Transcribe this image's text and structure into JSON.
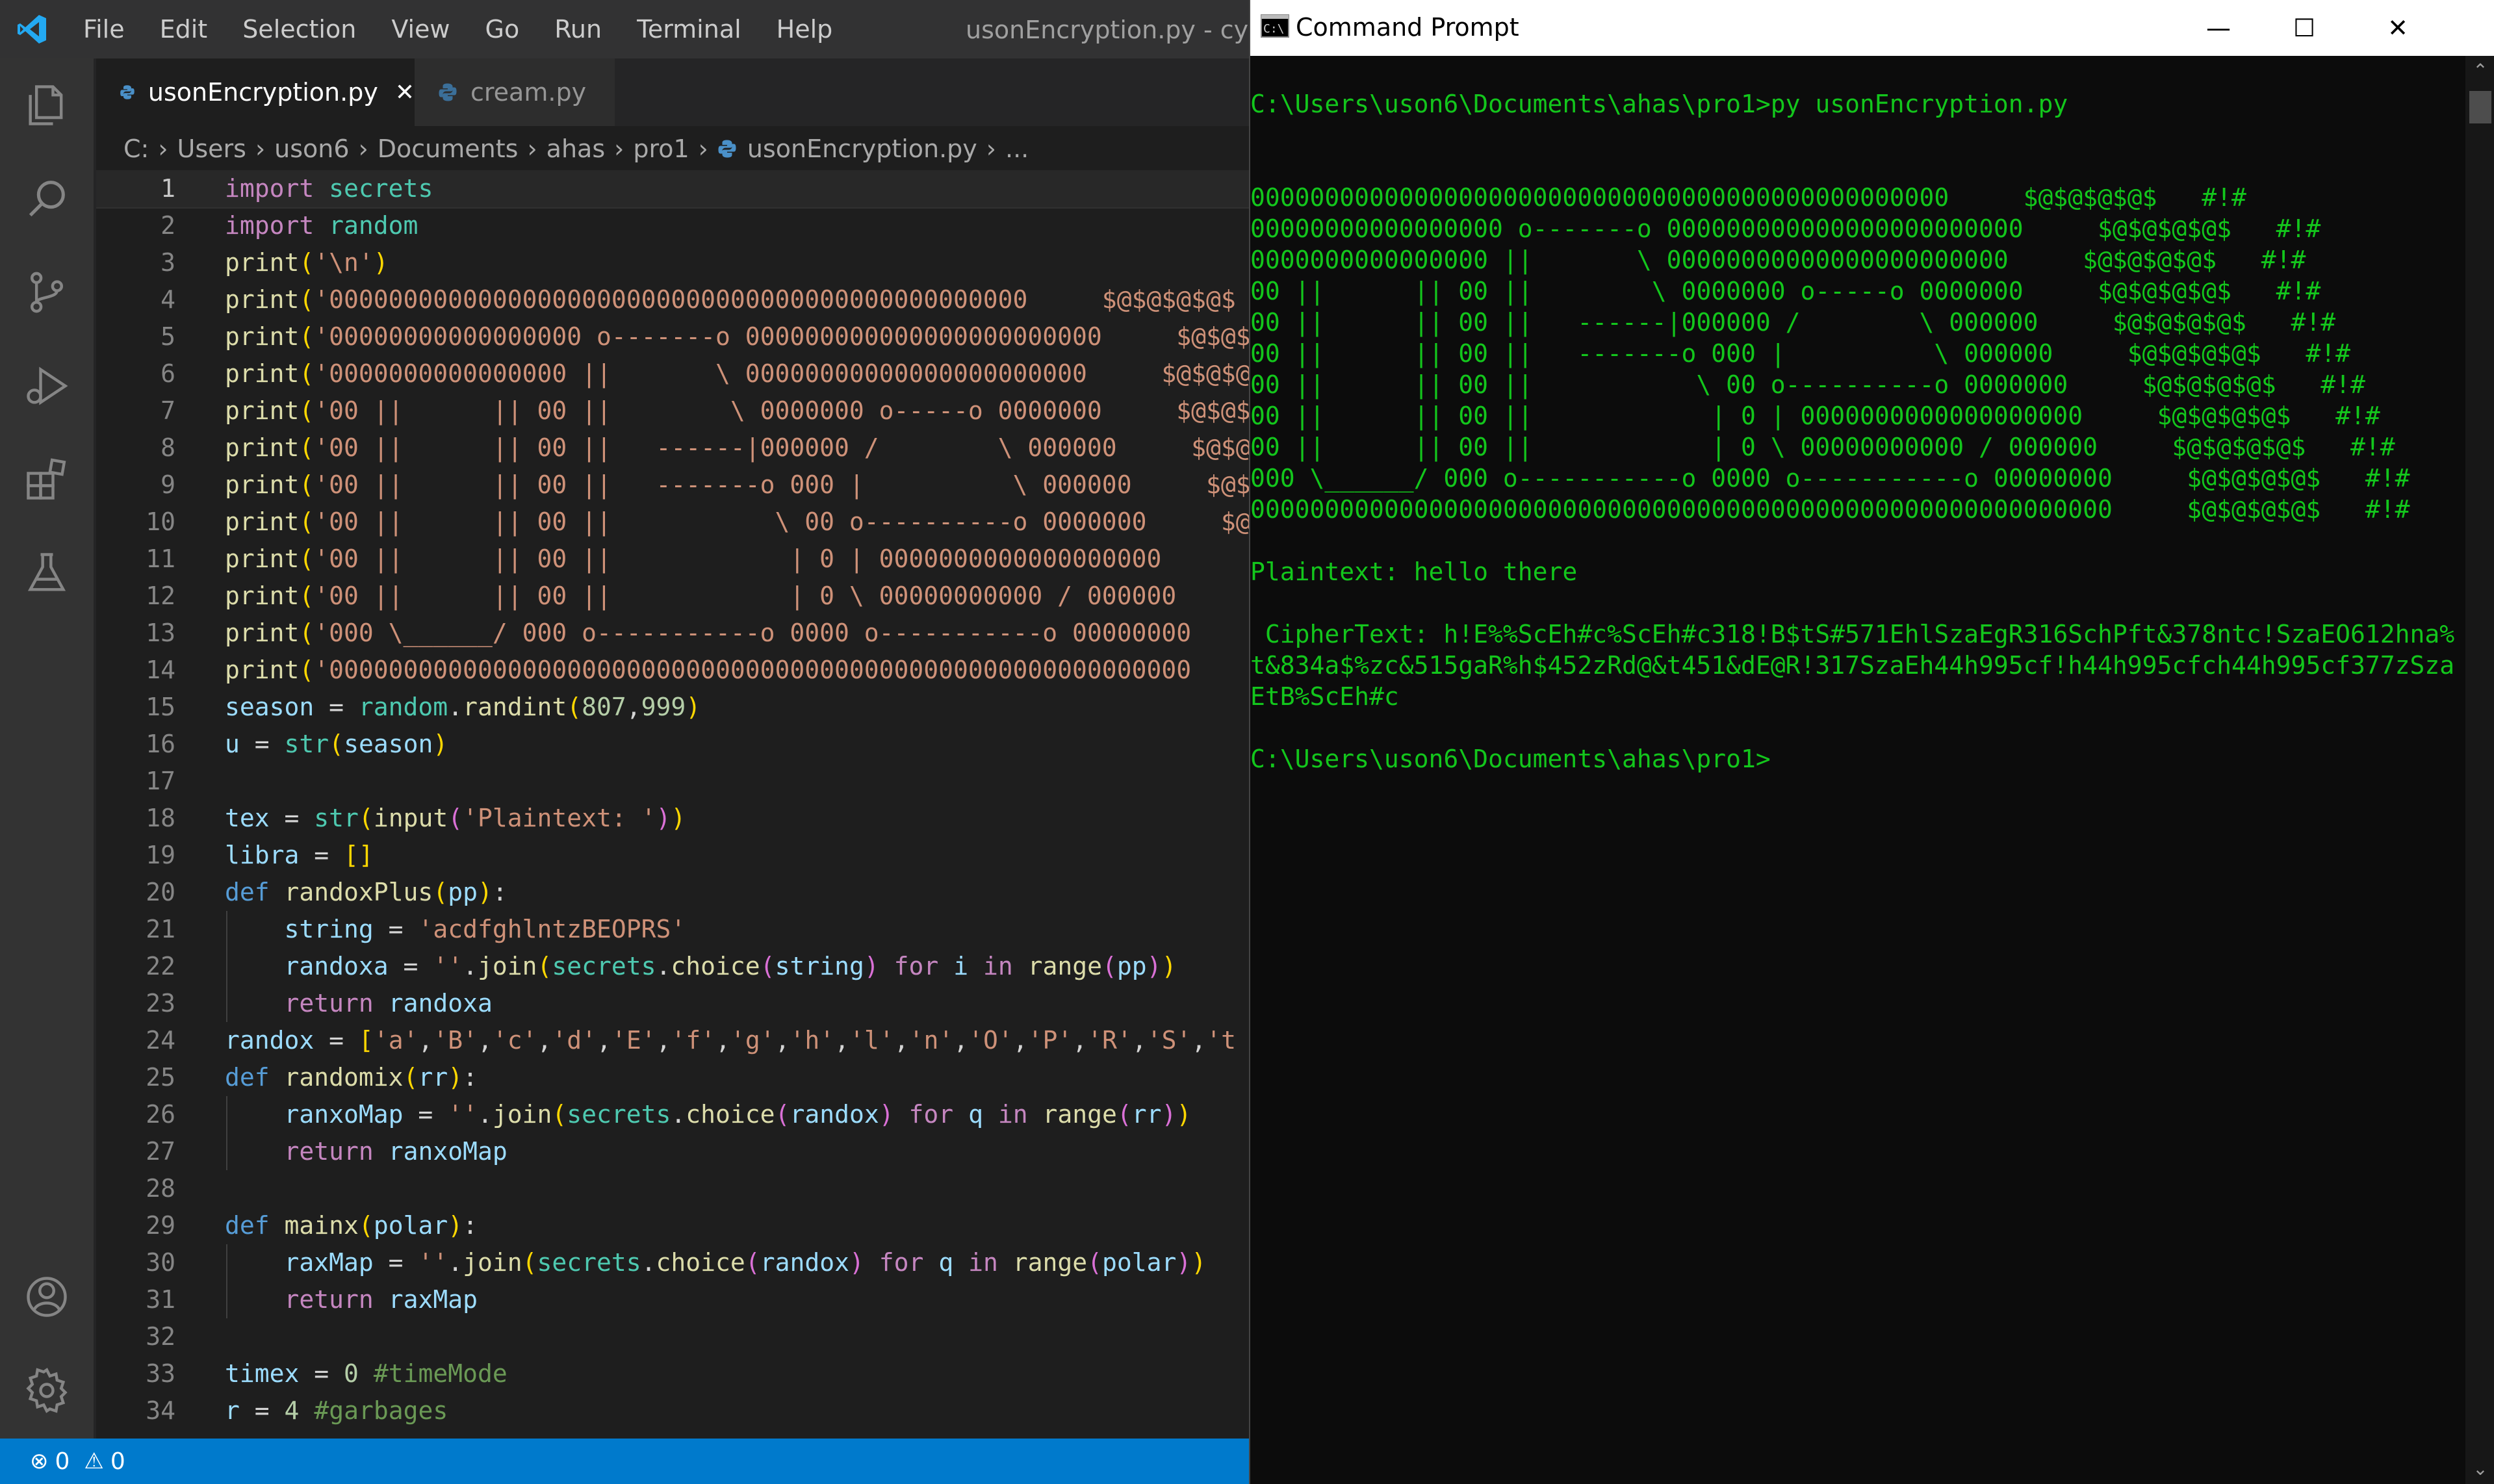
{
  "vscode": {
    "menu": [
      "File",
      "Edit",
      "Selection",
      "View",
      "Go",
      "Run",
      "Terminal",
      "Help"
    ],
    "window_title": "usonEncryption.py - cyberse",
    "tabs": [
      {
        "label": "usonEncryption.py",
        "close": "✕"
      },
      {
        "label": "cream.py"
      }
    ],
    "breadcrumb": [
      "C:",
      "Users",
      "uson6",
      "Documents",
      "ahas",
      "pro1",
      "usonEncryption.py",
      "..."
    ],
    "code_lines": [
      "1",
      "2",
      "3",
      "4",
      "5",
      "6",
      "7",
      "8",
      "9",
      "10",
      "11",
      "12",
      "13",
      "14",
      "15",
      "16",
      "17",
      "18",
      "19",
      "20",
      "21",
      "22",
      "23",
      "24",
      "25",
      "26",
      "27",
      "28",
      "29",
      "30",
      "31",
      "32",
      "33",
      "34"
    ],
    "status": {
      "errors": "0",
      "warnings": "0"
    }
  },
  "cmd": {
    "title": "Command Prompt",
    "lines": [
      "C:\\Users\\uson6\\Documents\\ahas\\pro1>py usonEncryption.py",
      "",
      "",
      "00000000000000000000000000000000000000000000000     $@$@$@$@$   #!#",
      "00000000000000000 o-------o 000000000000000000000000     $@$@$@$@$   #!#",
      "0000000000000000 ||       \\ 00000000000000000000000     $@$@$@$@$   #!#",
      "00 ||      || 00 ||        \\ 0000000 o-----o 0000000     $@$@$@$@$   #!#",
      "00 ||      || 00 ||   ------|000000 /        \\ 000000     $@$@$@$@$   #!#",
      "00 ||      || 00 ||   -------o 000 |          \\ 000000     $@$@$@$@$   #!#",
      "00 ||      || 00 ||           \\ 00 o----------o 0000000     $@$@$@$@$   #!#",
      "00 ||      || 00 ||            | 0 | 0000000000000000000     $@$@$@$@$   #!#",
      "00 ||      || 00 ||            | 0 \\ 00000000000 / 000000     $@$@$@$@$   #!#",
      "000 \\______/ 000 o-----------o 0000 o-----------o 00000000     $@$@$@$@$   #!#",
      "0000000000000000000000000000000000000000000000000000000000     $@$@$@$@$   #!#",
      "",
      "Plaintext: hello there",
      "",
      " CipherText: h!E%%ScEh#c%ScEh#c318!B$tS#571EhlSzaEgR316SchPft&378ntc!SzaEO612hna%",
      "t&834a$%zc&515gaR%h$452zRd@&t451&dE@R!317SzaEh44h995cf!h44h995cfch44h995cf377zSza",
      "EtB%ScEh#c",
      "",
      "C:\\Users\\uson6\\Documents\\ahas\\pro1>"
    ],
    "window_buttons": {
      "minimize": "—",
      "maximize": "☐",
      "close": "✕"
    }
  }
}
